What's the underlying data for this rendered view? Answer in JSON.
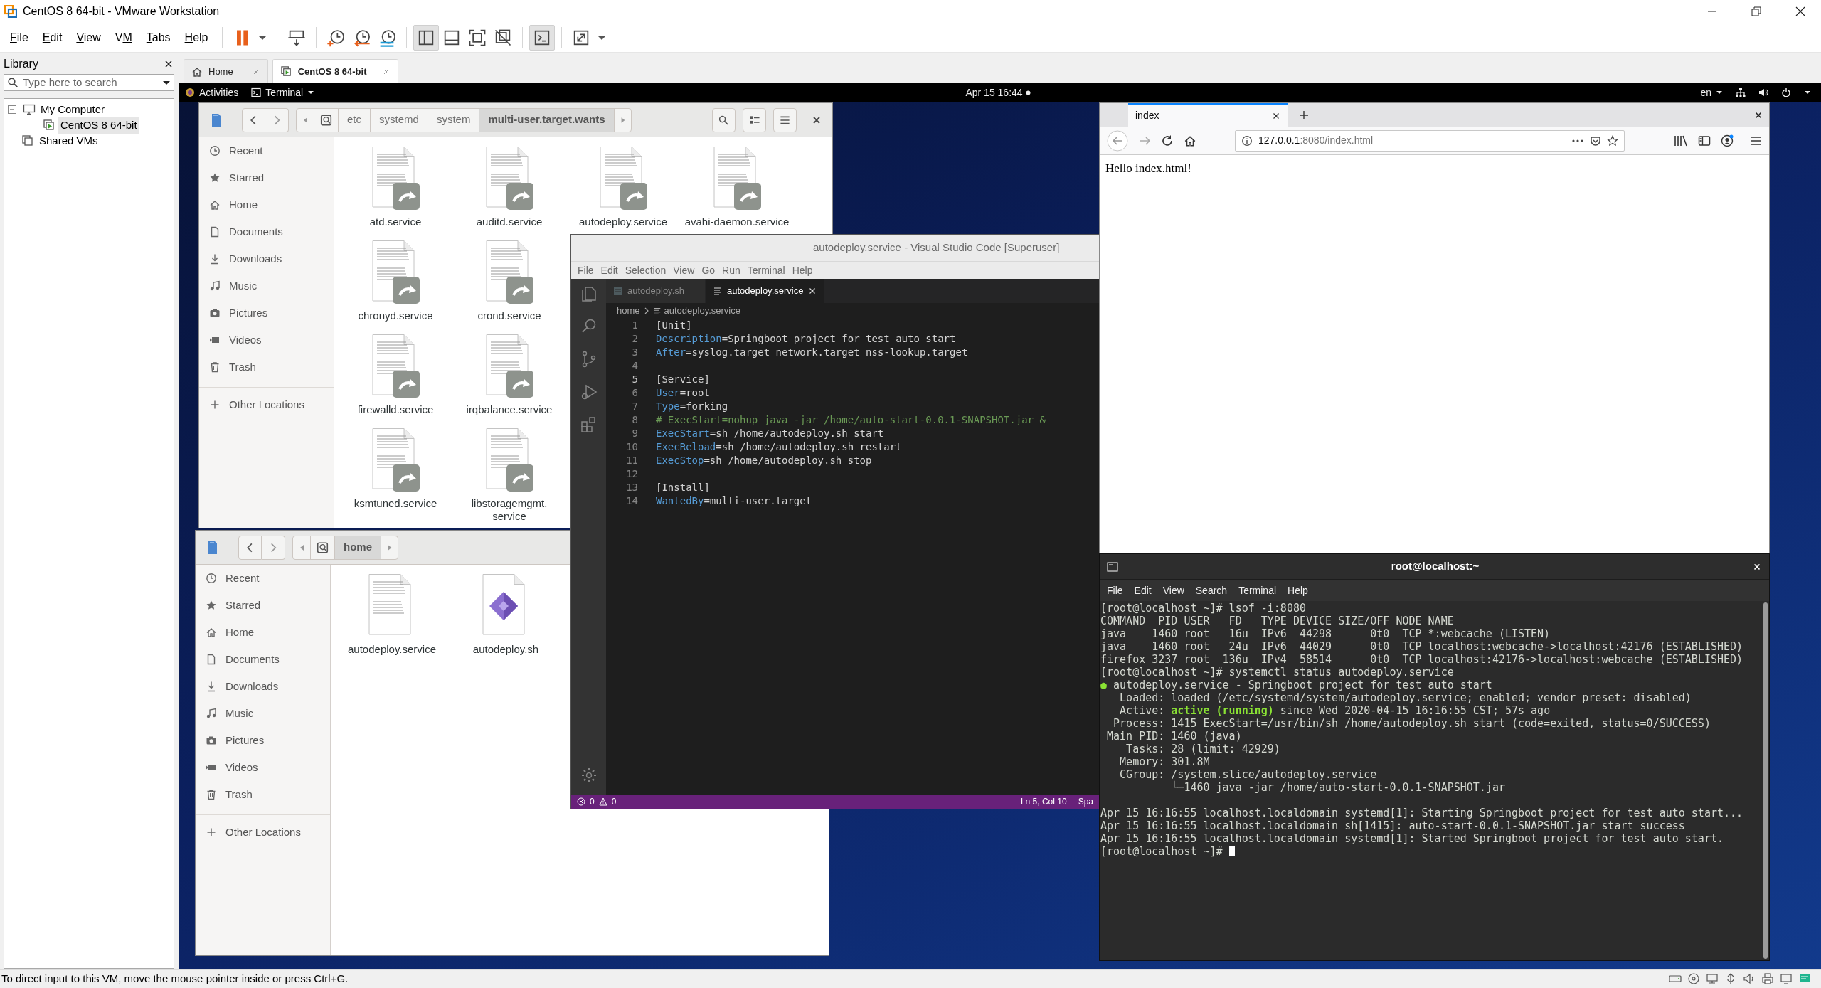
{
  "window": {
    "title": "CentOS 8 64-bit - VMware Workstation"
  },
  "menu": [
    {
      "key": "F",
      "rest": "ile"
    },
    {
      "key": "E",
      "rest": "dit"
    },
    {
      "key": "V",
      "rest": "iew"
    },
    {
      "lead": "V",
      "key": "M"
    },
    {
      "key": "T",
      "rest": "abs"
    },
    {
      "key": "H",
      "rest": "elp"
    }
  ],
  "toolbar": {
    "groups": [
      {
        "buttons": [
          {
            "kind": "pause",
            "selected": false
          },
          {
            "kind": "caret",
            "selected": false
          }
        ]
      },
      {
        "buttons": [
          {
            "kind": "send-keys",
            "selected": false
          }
        ]
      },
      {
        "buttons": [
          {
            "kind": "snapshot-take",
            "selected": false
          },
          {
            "kind": "snapshot-revert",
            "selected": false
          },
          {
            "kind": "snapshot-manager",
            "selected": false
          }
        ]
      },
      {
        "buttons": [
          {
            "kind": "view-library",
            "selected": true
          },
          {
            "kind": "view-thumbnail",
            "selected": false
          },
          {
            "kind": "view-fullscreen",
            "selected": false
          },
          {
            "kind": "view-unity",
            "selected": false
          }
        ]
      },
      {
        "buttons": [
          {
            "kind": "console",
            "selected": true
          }
        ]
      },
      {
        "buttons": [
          {
            "kind": "stretch",
            "selected": false
          },
          {
            "kind": "caret",
            "selected": false
          }
        ]
      }
    ]
  },
  "library": {
    "title": "Library",
    "search": {
      "placeholder": "Type here to search"
    },
    "tree": [
      {
        "label": "My Computer",
        "kind": "computer",
        "selected": false,
        "expanded": true,
        "children": [
          {
            "label": "CentOS 8 64-bit",
            "kind": "vm",
            "selected": true
          }
        ]
      },
      {
        "label": "Shared VMs",
        "kind": "shared",
        "selected": false
      }
    ]
  },
  "vm_tabs": [
    {
      "label": "Home",
      "kind": "home",
      "selected": false
    },
    {
      "label": "CentOS 8 64-bit",
      "kind": "vm",
      "selected": true
    }
  ],
  "guest": {
    "top_bar": {
      "activities": "Activities",
      "app_menu": "Terminal",
      "clock": "Apr 15  16:44",
      "keyboard": "en"
    },
    "files_windows": [
      {
        "header_buttons": [
          {
            "kind": "search"
          },
          {
            "kind": "view"
          },
          {
            "kind": "menu"
          },
          {
            "kind": "close"
          }
        ],
        "path": [
          {
            "label": "etc",
            "selected": false
          },
          {
            "label": "systemd",
            "selected": false
          },
          {
            "label": "system",
            "selected": false
          },
          {
            "label": "multi-user.target.wants",
            "selected": true
          }
        ],
        "sidebar": [
          {
            "label": "Recent",
            "kind": "recent"
          },
          {
            "label": "Starred",
            "kind": "starred"
          },
          {
            "label": "Home",
            "kind": "home"
          },
          {
            "label": "Documents",
            "kind": "documents"
          },
          {
            "label": "Downloads",
            "kind": "downloads"
          },
          {
            "label": "Music",
            "kind": "music"
          },
          {
            "label": "Pictures",
            "kind": "pictures"
          },
          {
            "label": "Videos",
            "kind": "videos"
          },
          {
            "label": "Trash",
            "kind": "trash"
          },
          {
            "label": "Other Locations",
            "kind": "other"
          }
        ],
        "rows": [
          {
            "files": [
              {
                "name": "atd.service",
                "kind": "link"
              },
              {
                "name": "auditd.service",
                "kind": "link"
              },
              {
                "name": "autodeploy.service",
                "kind": "link"
              },
              {
                "name": "avahi-daemon.service",
                "kind": "link"
              }
            ]
          },
          {
            "files": [
              {
                "name": "chronyd.service",
                "kind": "link"
              },
              {
                "name": "crond.service",
                "kind": "link"
              }
            ]
          },
          {
            "files": [
              {
                "name": "firewalld.service",
                "kind": "link"
              },
              {
                "name": "irqbalance.service",
                "kind": "link"
              }
            ]
          },
          {
            "files": [
              {
                "name": "ksmtuned.service",
                "kind": "link"
              },
              {
                "name": "libstoragemgmt.service",
                "kind": "link"
              }
            ]
          }
        ]
      },
      {
        "path": [
          {
            "label": "home",
            "selected": true
          }
        ],
        "sidebar": [
          {
            "label": "Recent",
            "kind": "recent"
          },
          {
            "label": "Starred",
            "kind": "starred"
          },
          {
            "label": "Home",
            "kind": "home"
          },
          {
            "label": "Documents",
            "kind": "documents"
          },
          {
            "label": "Downloads",
            "kind": "downloads"
          },
          {
            "label": "Music",
            "kind": "music"
          },
          {
            "label": "Pictures",
            "kind": "pictures"
          },
          {
            "label": "Videos",
            "kind": "videos"
          },
          {
            "label": "Trash",
            "kind": "trash"
          },
          {
            "label": "Other Locations",
            "kind": "other"
          }
        ],
        "rows": [
          {
            "files": [
              {
                "name": "autodeploy.service",
                "kind": "text"
              },
              {
                "name": "autodeploy.sh",
                "kind": "script"
              }
            ]
          }
        ]
      }
    ],
    "vscode": {
      "title": "autodeploy.service - Visual Studio Code [Superuser]",
      "menu": [
        "File",
        "Edit",
        "Selection",
        "View",
        "Go",
        "Run",
        "Terminal",
        "Help"
      ],
      "tabs": [
        {
          "label": "autodeploy.sh",
          "kind": "shell",
          "selected": false
        },
        {
          "label": "autodeploy.service",
          "kind": "text",
          "selected": true
        }
      ],
      "breadcrumb": [
        "home",
        "autodeploy.service"
      ],
      "lines": [
        {
          "number": "1",
          "kind": "section",
          "text": "[Unit]",
          "current": false
        },
        {
          "number": "2",
          "kind": "setting",
          "key": "Description",
          "value": "=Springboot project for test auto start",
          "current": false
        },
        {
          "number": "3",
          "kind": "setting",
          "key": "After",
          "value": "=syslog.target network.target nss-lookup.target",
          "current": false
        },
        {
          "number": "4",
          "kind": "blank",
          "current": false
        },
        {
          "number": "5",
          "kind": "section",
          "text": "[Service]",
          "current": true
        },
        {
          "number": "6",
          "kind": "setting",
          "key": "User",
          "value": "=root",
          "current": false
        },
        {
          "number": "7",
          "kind": "setting",
          "key": "Type",
          "value": "=forking",
          "current": false
        },
        {
          "number": "8",
          "kind": "comment",
          "text": "# ExecStart=nohup java -jar /home/auto-start-0.0.1-SNAPSHOT.jar &",
          "current": false
        },
        {
          "number": "9",
          "kind": "setting",
          "key": "ExecStart",
          "value": "=sh /home/autodeploy.sh start",
          "current": false
        },
        {
          "number": "10",
          "kind": "setting",
          "key": "ExecReload",
          "value": "=sh /home/autodeploy.sh restart",
          "current": false
        },
        {
          "number": "11",
          "kind": "setting",
          "key": "ExecStop",
          "value": "=sh /home/autodeploy.sh stop",
          "current": false
        },
        {
          "number": "12",
          "kind": "blank",
          "current": false
        },
        {
          "number": "13",
          "kind": "section",
          "text": "[Install]",
          "current": false
        },
        {
          "number": "14",
          "kind": "setting",
          "key": "WantedBy",
          "value": "=multi-user.target",
          "current": false
        }
      ],
      "status": {
        "errors": "0",
        "warnings": "0",
        "position": "Ln 5, Col 10",
        "indent": "Spa"
      }
    },
    "firefox": {
      "tabs": [
        {
          "label": "index",
          "selected": true
        }
      ],
      "url": {
        "host": "127.0.0.1",
        "rest": ":8080/index.html"
      },
      "content": "Hello index.html!"
    },
    "terminal": {
      "title": "root@localhost:~",
      "menu": [
        "File",
        "Edit",
        "View",
        "Search",
        "Terminal",
        "Help"
      ],
      "lines": [
        {
          "kind": "output",
          "text": "[root@localhost ~]# lsof -i:8080"
        },
        {
          "kind": "output",
          "text": "COMMAND  PID USER   FD   TYPE DEVICE SIZE/OFF NODE NAME"
        },
        {
          "kind": "output",
          "text": "java    1460 root   16u  IPv6  44298      0t0  TCP *:webcache (LISTEN)"
        },
        {
          "kind": "output",
          "text": "java    1460 root   24u  IPv6  44029      0t0  TCP localhost:webcache->localhost:42176 (ESTABLISHED)"
        },
        {
          "kind": "output",
          "text": "firefox 3237 root  136u  IPv4  58514      0t0  TCP localhost:42176->localhost:webcache (ESTABLISHED)"
        },
        {
          "kind": "output",
          "text": "[root@localhost ~]# systemctl status autodeploy.service"
        },
        {
          "kind": "styled",
          "parts": [
            {
              "text": "●",
              "kind": "ok"
            },
            {
              "text": " autodeploy.service - Springboot project for test auto start",
              "kind": "plain"
            }
          ]
        },
        {
          "kind": "output",
          "text": "   Loaded: loaded (/etc/systemd/system/autodeploy.service; enabled; vendor preset: disabled)"
        },
        {
          "kind": "styled",
          "parts": [
            {
              "text": "   Active: ",
              "kind": "plain"
            },
            {
              "text": "active (running)",
              "kind": "ok"
            },
            {
              "text": " since Wed 2020-04-15 16:16:55 CST; 57s ago",
              "kind": "plain"
            }
          ]
        },
        {
          "kind": "output",
          "text": "  Process: 1415 ExecStart=/usr/bin/sh /home/autodeploy.sh start (code=exited, status=0/SUCCESS)"
        },
        {
          "kind": "output",
          "text": " Main PID: 1460 (java)"
        },
        {
          "kind": "output",
          "text": "    Tasks: 28 (limit: 42929)"
        },
        {
          "kind": "output",
          "text": "   Memory: 301.8M"
        },
        {
          "kind": "output",
          "text": "   CGroup: /system.slice/autodeploy.service"
        },
        {
          "kind": "output",
          "text": "           └─1460 java -jar /home/auto-start-0.0.1-SNAPSHOT.jar"
        },
        {
          "kind": "blank"
        },
        {
          "kind": "output",
          "text": "Apr 15 16:16:55 localhost.localdomain systemd[1]: Starting Springboot project for test auto start..."
        },
        {
          "kind": "output",
          "text": "Apr 15 16:16:55 localhost.localdomain sh[1415]: auto-start-0.0.1-SNAPSHOT.jar start success"
        },
        {
          "kind": "output",
          "text": "Apr 15 16:16:55 localhost.localdomain systemd[1]: Started Springboot project for test auto start."
        },
        {
          "kind": "prompt",
          "text": "[root@localhost ~]# "
        }
      ]
    }
  },
  "status_bar": {
    "text": "To direct input to this VM, move the mouse pointer inside or press Ctrl+G."
  }
}
